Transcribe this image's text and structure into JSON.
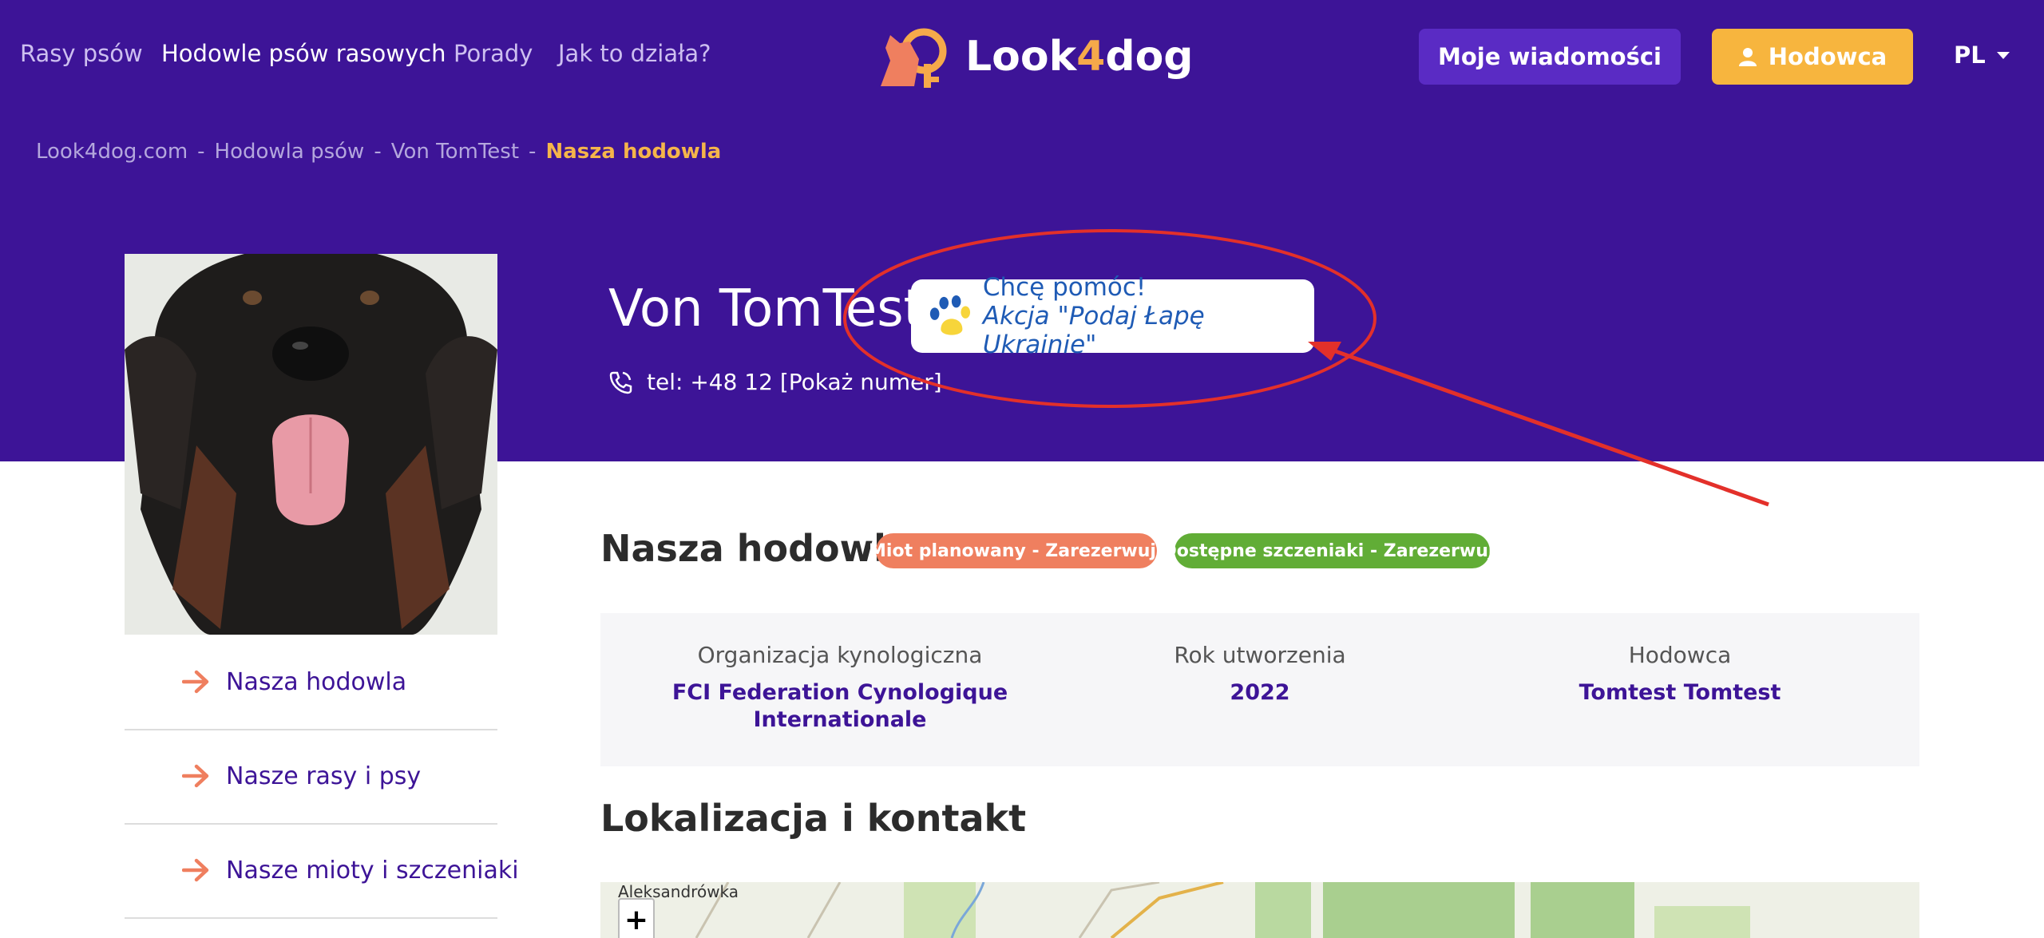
{
  "nav": {
    "items": [
      "Rasy psów",
      "Hodowle psów rasowych",
      "Porady",
      "Jak to działa?"
    ],
    "active_index": 1,
    "logo_text_prefix": "Look",
    "logo_text_four": "4",
    "logo_text_suffix": "dog",
    "messages_button": "Moje wiadomości",
    "breeder_button": "Hodowca",
    "language": "PL"
  },
  "breadcrumb": [
    "Look4dog.com",
    "Hodowla psów",
    "Von TomTest",
    "Nasza hodowla"
  ],
  "breadcrumb_separator": "-",
  "kennel": {
    "name": "Von TomTest",
    "phone": "tel: +48 12 [Pokaż numer]"
  },
  "help_card": {
    "line1": "Chcę pomóc!",
    "line2": "Akcja \"Podaj Łapę Ukrainie\""
  },
  "sidebar": {
    "items": [
      "Nasza hodowla",
      "Nasze rasy i psy",
      "Nasze mioty i szczeniaki"
    ]
  },
  "main": {
    "section_title": "Nasza hodowla",
    "badge_planned": "Miot planowany - Zarezerwuj!",
    "badge_available": "Dostępne szczeniaki - Zarezerwuj!",
    "info": [
      {
        "label": "Organizacja kynologiczna",
        "value_line1": "FCI Federation Cynologique",
        "value_line2": "Internationale"
      },
      {
        "label": "Rok utworzenia",
        "value_line1": "2022",
        "value_line2": ""
      },
      {
        "label": "Hodowca",
        "value_line1": "Tomtest Tomtest",
        "value_line2": ""
      }
    ],
    "location_title": "Lokalizacja i kontakt"
  },
  "map": {
    "town_label": "Aleksandrówka",
    "zoom_in": "+"
  },
  "colors": {
    "header_bg": "#3d1497",
    "accent_orange": "#f7b53e",
    "badge_orange": "#ef7f5f",
    "badge_green": "#61ad36",
    "annotation_red": "#e3302a"
  }
}
